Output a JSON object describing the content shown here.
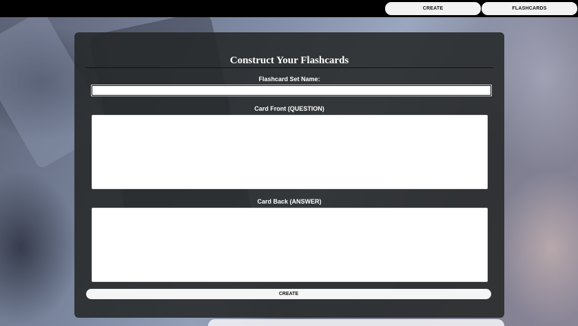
{
  "nav": {
    "create_label": "CREATE",
    "flashcards_label": "FLASHCARDS"
  },
  "form": {
    "title": "Construct Your Flashcards",
    "set_name_label": "Flashcard Set Name:",
    "set_name_value": "",
    "front_label": "Card Front (QUESTION)",
    "front_value": "",
    "back_label": "Card Back (ANSWER)",
    "back_value": "",
    "submit_label": "CREATE"
  },
  "colors": {
    "topbar": "#000000",
    "panel": "#262828",
    "button": "#f2f2f2"
  }
}
